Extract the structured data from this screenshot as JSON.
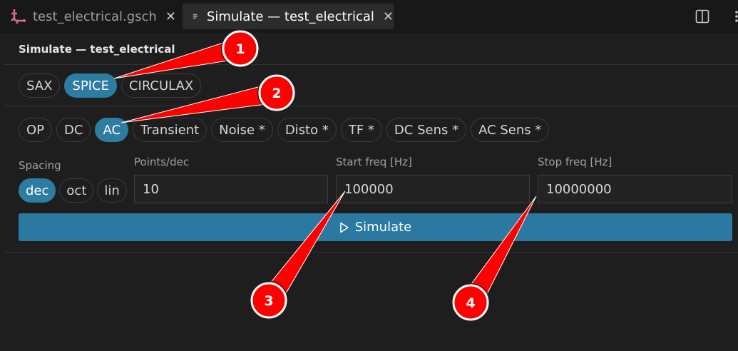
{
  "tabs": [
    {
      "label": "test_electrical.gsch",
      "icon": "schematic-icon",
      "icon_color": "#d16f84"
    },
    {
      "label": "Simulate — test_electrical",
      "icon": "lines-icon"
    }
  ],
  "panel": {
    "title": "Simulate — test_electrical"
  },
  "engines": {
    "items": [
      {
        "label": "SAX"
      },
      {
        "label": "SPICE"
      },
      {
        "label": "CIRCULAX"
      }
    ],
    "selected": "SPICE"
  },
  "analyses": {
    "items": [
      {
        "label": "OP"
      },
      {
        "label": "DC"
      },
      {
        "label": "AC"
      },
      {
        "label": "Transient"
      },
      {
        "label": "Noise *"
      },
      {
        "label": "Disto *"
      },
      {
        "label": "TF *"
      },
      {
        "label": "DC Sens *"
      },
      {
        "label": "AC Sens *"
      }
    ],
    "selected": "AC"
  },
  "spacing": {
    "label": "Spacing",
    "items": [
      {
        "label": "dec"
      },
      {
        "label": "oct"
      },
      {
        "label": "lin"
      }
    ],
    "selected": "dec"
  },
  "fields": {
    "points_label": "Points/dec",
    "points_value": "10",
    "start_label": "Start freq [Hz]",
    "start_value": "100000",
    "stop_label": "Stop freq [Hz]",
    "stop_value": "10000000"
  },
  "simulate_button": {
    "label": "Simulate"
  },
  "callouts": [
    "1",
    "2",
    "3",
    "4"
  ],
  "colors": {
    "accent": "#2d7ca1",
    "callout": "#ff0000"
  }
}
